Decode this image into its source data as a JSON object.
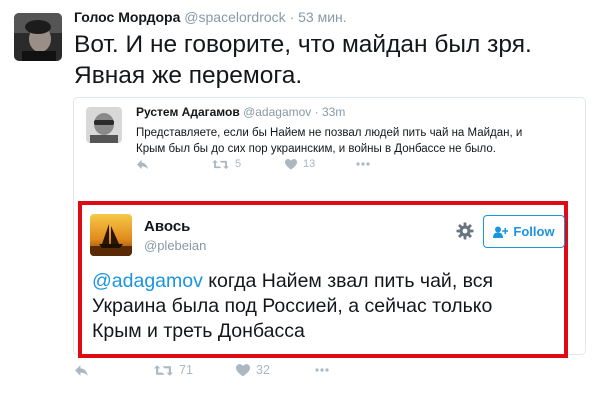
{
  "outer_tweet": {
    "author_name": "Голос Мордора",
    "author_handle": "@spacelordrock",
    "time_separator": "·",
    "time": "53 мин.",
    "text_line1": "Вот. И не говорите, что майдан был зря.",
    "text_line2": "Явная же перемога.",
    "actions": {
      "reply_icon": "reply-icon",
      "retweet_icon": "retweet-icon",
      "retweet_count": "71",
      "like_icon": "heart-icon",
      "like_count": "32",
      "more_icon": "more-icon"
    }
  },
  "quoted_tweet": {
    "author_name": "Рустем Адагамов",
    "author_handle": "@adagamov",
    "time_separator": "·",
    "time": "33m",
    "text_line1": "Представляете, если бы Найем не позвал людей пить чай на Майдан, и",
    "text_line2": "Крым был бы до сих пор украинским, и войны в Донбассе не было.",
    "actions": {
      "retweet_count": "5",
      "like_count": "13"
    }
  },
  "reply_card": {
    "author_name": "Авось",
    "author_handle": "@plebeian",
    "follow_label": "Follow",
    "mention": "@adagamov",
    "text_after_mention": " когда Найем звал пить чай, вся",
    "text_line2": "Украина была под Россией, а сейчас только",
    "text_line3": "Крым и треть Донбасса",
    "highlight_color": "#e00a14"
  },
  "colors": {
    "link_blue": "#1b95e0",
    "muted_gray": "#8899a6",
    "icon_gray": "#aab8c2"
  }
}
